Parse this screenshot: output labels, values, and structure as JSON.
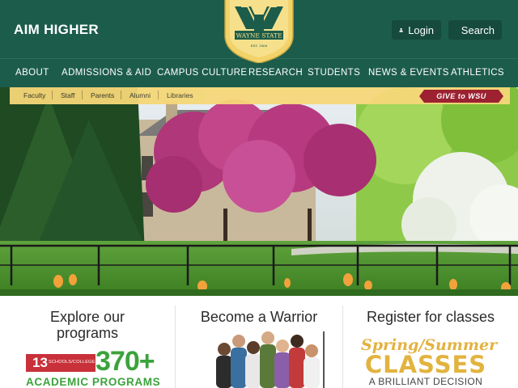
{
  "header": {
    "tagline": "AIM HIGHER",
    "login_label": "Login",
    "search_label": "Search",
    "logo_text": "WAYNE STATE",
    "logo_est": "EST. 1868"
  },
  "nav": {
    "items": [
      "ABOUT",
      "ADMISSIONS & AID",
      "CAMPUS CULTURE",
      "RESEARCH",
      "STUDENTS",
      "NEWS & EVENTS",
      "ATHLETICS"
    ]
  },
  "audience": {
    "items": [
      "Faculty",
      "Staff",
      "Parents",
      "Alumni",
      "Libraries"
    ],
    "give_label": "GIVE to WSU"
  },
  "cards": {
    "programs": {
      "title_line1": "Explore our",
      "title_line2": "programs",
      "badge_num": "13",
      "badge_label": "SCHOOLS/COLLEGES",
      "big_number": "370+",
      "sub_label": "ACADEMIC PROGRAMS"
    },
    "warrior": {
      "title": "Become a Warrior"
    },
    "register": {
      "title": "Register for classes",
      "promo_line1": "Spring/Summer",
      "promo_line2": "CLASSES",
      "promo_line3": "A BRILLIANT DECISION"
    }
  },
  "colors": {
    "primary_green": "#1c5c4b",
    "gold": "#f5d778",
    "give_red": "#9c2231",
    "program_green": "#3ba33b",
    "badge_red": "#c8313a"
  }
}
